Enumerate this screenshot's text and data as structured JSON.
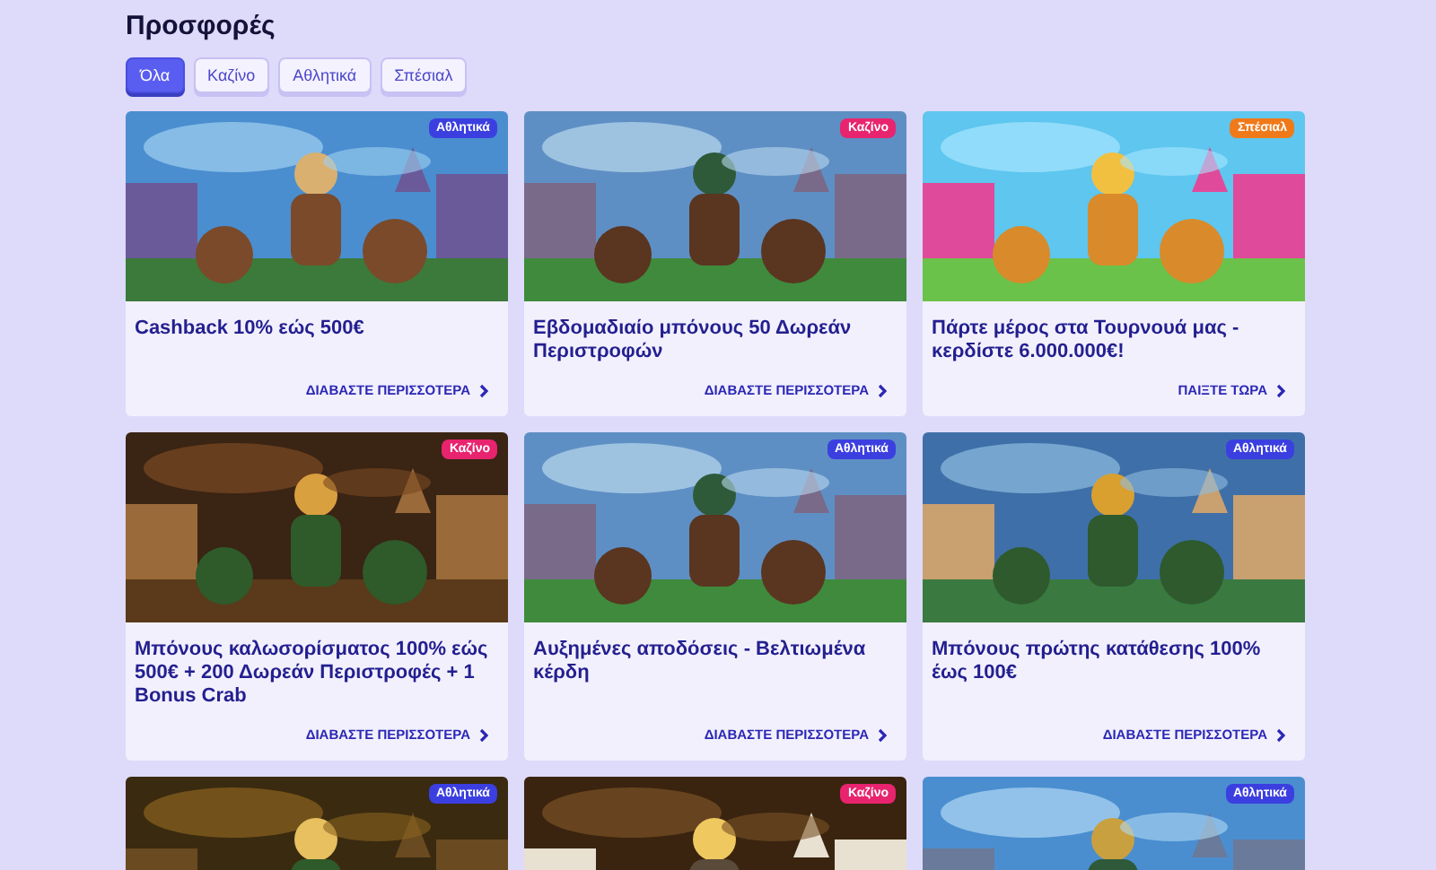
{
  "page_title": "Προσφορές",
  "tabs": [
    {
      "label": "Όλα",
      "selected": true
    },
    {
      "label": "Καζίνο",
      "selected": false
    },
    {
      "label": "Αθλητικά",
      "selected": false
    },
    {
      "label": "Σπέσιαλ",
      "selected": false
    }
  ],
  "offers": [
    {
      "badge": {
        "label": "Αθλητικά",
        "color": "#3b3fe0"
      },
      "title": "Cashback 10% εώς 500€",
      "link": "ΔΙΑΒΑΣΤΕ ΠΕΡΙΣΣΟΤΕΡΑ"
    },
    {
      "badge": {
        "label": "Καζίνο",
        "color": "#e8246e"
      },
      "title": "Εβδομαδιαίο μπόνους 50 Δωρεάν Περιστροφών",
      "link": "ΔΙΑΒΑΣΤΕ ΠΕΡΙΣΣΟΤΕΡΑ"
    },
    {
      "badge": {
        "label": "Σπέσιαλ",
        "color": "#f07a1a"
      },
      "title": "Πάρτε μέρος στα Τουρνουά μας - κερδίστε 6.000.000€!",
      "link": "ΠΑΙΞΤΕ ΤΩΡΑ"
    },
    {
      "badge": {
        "label": "Καζίνο",
        "color": "#e8246e"
      },
      "title": "Μπόνους καλωσορίσματος 100% εώς 500€ + 200 Δωρεάν Περιστροφές + 1 Bonus Crab",
      "link": "ΔΙΑΒΑΣΤΕ ΠΕΡΙΣΣΟΤΕΡΑ"
    },
    {
      "badge": {
        "label": "Αθλητικά",
        "color": "#3b3fe0"
      },
      "title": "Αυξημένες αποδόσεις - Βελτιωμένα κέρδη",
      "link": "ΔΙΑΒΑΣΤΕ ΠΕΡΙΣΣΟΤΕΡΑ"
    },
    {
      "badge": {
        "label": "Αθλητικά",
        "color": "#3b3fe0"
      },
      "title": "Μπόνους πρώτης κατάθεσης 100% έως 100€",
      "link": "ΔΙΑΒΑΣΤΕ ΠΕΡΙΣΣΟΤΕΡΑ"
    },
    {
      "badge": {
        "label": "Αθλητικά",
        "color": "#3b3fe0"
      }
    },
    {
      "badge": {
        "label": "Καζίνο",
        "color": "#e8246e"
      }
    },
    {
      "badge": {
        "label": "Αθλητικά",
        "color": "#3b3fe0"
      }
    }
  ]
}
